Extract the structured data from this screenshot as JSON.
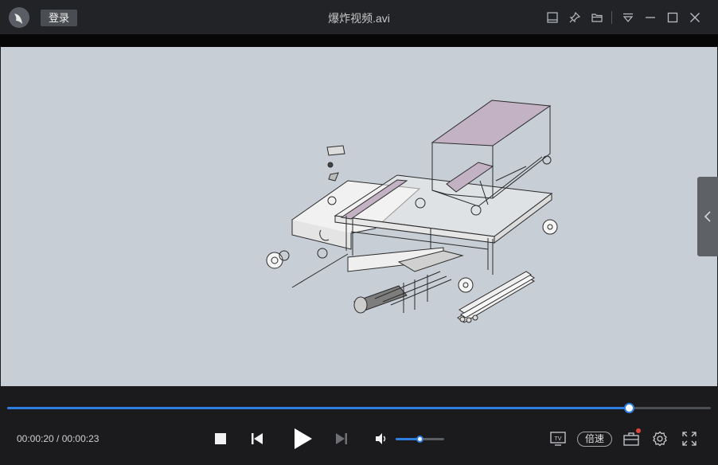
{
  "app": {
    "login_label": "登录",
    "window_title": "爆炸视频.avi"
  },
  "titlebar_icons": [
    "dock-icon",
    "pin-icon",
    "folder-icon",
    "dropdown-menu-icon",
    "minimize-icon",
    "maximize-icon",
    "close-icon"
  ],
  "player": {
    "current_time": "00:00:20",
    "separator": " / ",
    "total_time": "00:00:23",
    "progress_fraction": 0.883,
    "volume_fraction": 0.49,
    "speed_label": "倍速",
    "tv_label": "TV"
  },
  "colors": {
    "accent": "#2f7fe0",
    "video_background": "#c8ced6",
    "notification_dot": "#e0443a",
    "hopper_fill": "#c3b1c4"
  }
}
